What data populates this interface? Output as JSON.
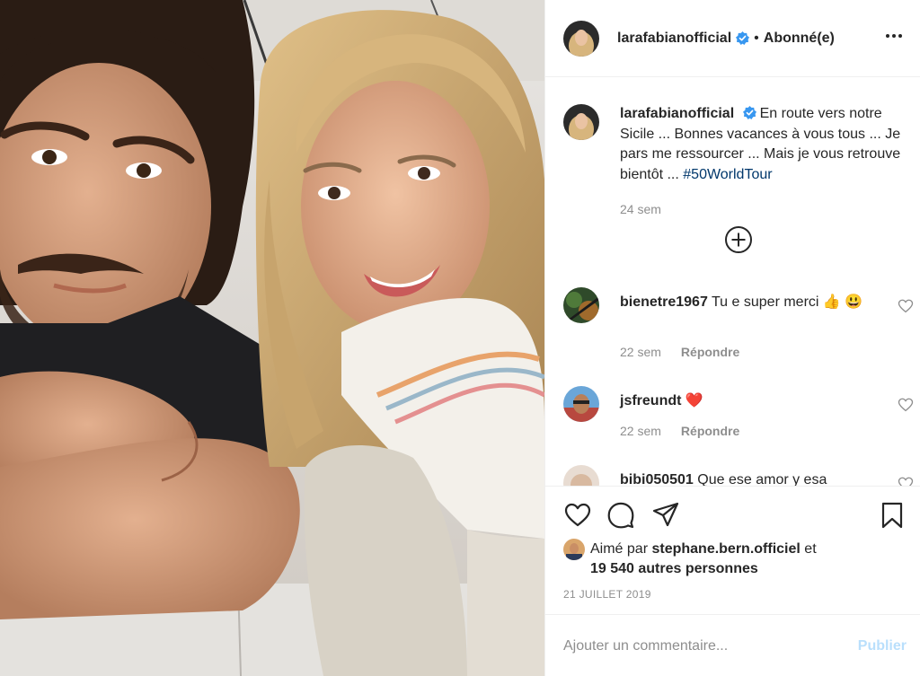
{
  "photo": {
    "alt": "Selfie of two people in an airplane cabin"
  },
  "header": {
    "username": "larafabianofficial",
    "separator": "•",
    "follow_status": "Abonné(e)"
  },
  "caption": {
    "username": "larafabianofficial",
    "text": "En route vers notre Sicile ... Bonnes vacances à vous tous ... Je pars me ressourcer ... Mais je vous retrouve bientôt ... ",
    "hashtag": "#50WorldTour",
    "time": "24 sem"
  },
  "comments": [
    {
      "username": "bienetre1967",
      "text": "Tu e super merci 👍 😃",
      "time": "22 sem",
      "reply": "Répondre"
    },
    {
      "username": "jsfreundt",
      "text": "❤️",
      "time": "22 sem",
      "reply": "Répondre"
    },
    {
      "username": "bibi050501",
      "text": "Que ese amor y esa"
    }
  ],
  "likes": {
    "prefix": "Aimé par ",
    "liker": "stephane.bern.officiel",
    "conjunction": " et",
    "others": "19 540 autres personnes"
  },
  "date": "21 JUILLET 2019",
  "add_comment": {
    "placeholder": "Ajouter un commentaire...",
    "publish": "Publier"
  },
  "colors": {
    "text": "#262626",
    "secondary": "#8e8e8e",
    "link": "#00376b",
    "verified": "#3897f0",
    "publish_disabled": "#b9dffc",
    "like_heart": "#ed4956"
  },
  "icons": {
    "more": "more-options-icon",
    "verified": "verified-badge-icon",
    "load_more": "plus-circle-icon",
    "like": "heart-icon",
    "comment": "comment-bubble-icon",
    "share": "paper-plane-icon",
    "save": "bookmark-icon"
  }
}
